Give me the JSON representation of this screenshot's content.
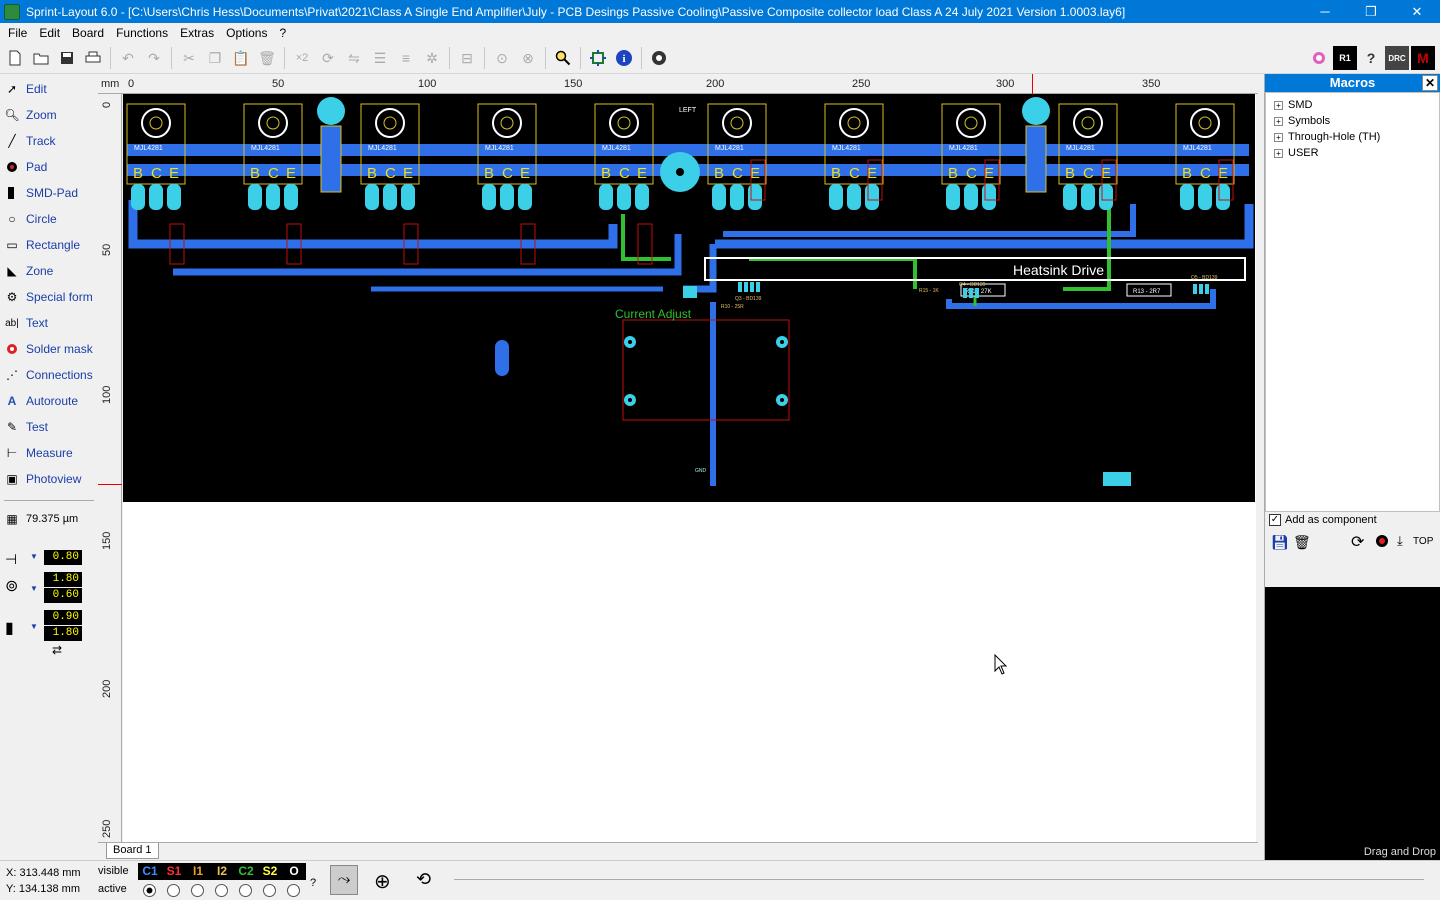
{
  "window": {
    "title": "Sprint-Layout 6.0 - [C:\\Users\\Chris Hess\\Documents\\Privat\\2021\\Class A Single End Amplifier\\July - PCB Desings Passive Cooling\\Passive Composite collector load Class A 24 July 2021 Version 1.0003.lay6]",
    "minimize": "─",
    "maximize": "❐",
    "close": "✕"
  },
  "menu": [
    "File",
    "Edit",
    "Board",
    "Functions",
    "Extras",
    "Options",
    "?"
  ],
  "toolbar": {
    "x2_label": "×2"
  },
  "tools": [
    {
      "label": "Edit",
      "icon": "pointer-icon"
    },
    {
      "label": "Zoom",
      "icon": "zoom-icon"
    },
    {
      "label": "Track",
      "icon": "track-icon"
    },
    {
      "label": "Pad",
      "icon": "pad-icon"
    },
    {
      "label": "SMD-Pad",
      "icon": "smd-pad-icon"
    },
    {
      "label": "Circle",
      "icon": "circle-icon"
    },
    {
      "label": "Rectangle",
      "icon": "rectangle-icon"
    },
    {
      "label": "Zone",
      "icon": "zone-icon"
    },
    {
      "label": "Special form",
      "icon": "special-form-icon"
    },
    {
      "label": "Text",
      "icon": "text-icon"
    },
    {
      "label": "Solder mask",
      "icon": "solder-mask-icon"
    },
    {
      "label": "Connections",
      "icon": "connections-icon"
    },
    {
      "label": "Autoroute",
      "icon": "autoroute-icon"
    },
    {
      "label": "Test",
      "icon": "test-icon"
    },
    {
      "label": "Measure",
      "icon": "measure-icon"
    },
    {
      "label": "Photoview",
      "icon": "photoview-icon"
    }
  ],
  "grid": {
    "value": "79.375 µm"
  },
  "params": {
    "track_width": "0.80",
    "pad_outer": "1.80",
    "pad_inner": "0.60",
    "smd_width": "0.90",
    "smd_height": "1.80"
  },
  "ruler": {
    "unit": "mm",
    "top_ticks": [
      "0",
      "50",
      "100",
      "150",
      "200",
      "250",
      "300",
      "350"
    ],
    "left_ticks": [
      "0",
      "50",
      "100",
      "150",
      "200",
      "250"
    ]
  },
  "pcb": {
    "transistor_label": "MJL4281",
    "pins": [
      "B",
      "C",
      "E"
    ],
    "heatsink_label": "Heatsink Drive",
    "current_adjust_label": "Current Adjust",
    "left_label": "LEFT",
    "gnd_label": "GND",
    "r10": "R10 - 25R",
    "r11": "R11 - 27K",
    "r13": "R13 - 2R7",
    "r15": "R15 - 1K",
    "q3": "Q3 - BD139",
    "q4": "Q4 - BD139",
    "q5": "Q5 - BD139"
  },
  "macros": {
    "title": "Macros",
    "tree": [
      "SMD",
      "Symbols",
      "Through-Hole (TH)",
      "USER"
    ],
    "add_as_component": "Add as component",
    "top_label": "TOP",
    "drag_drop": "Drag and Drop"
  },
  "tabs": [
    {
      "label": "Board 1"
    }
  ],
  "status": {
    "x": "X:  313.448 mm",
    "y": "Y:  134.138 mm",
    "visible": "visible",
    "active": "active",
    "question": "?",
    "layers": [
      {
        "name": "C1",
        "color": "#3c8cff"
      },
      {
        "name": "S1",
        "color": "#ff3030"
      },
      {
        "name": "I1",
        "color": "#e8a030"
      },
      {
        "name": "I2",
        "color": "#e8c060"
      },
      {
        "name": "C2",
        "color": "#30c030"
      },
      {
        "name": "S2",
        "color": "#ffff40"
      },
      {
        "name": "O",
        "color": "#ffffff"
      }
    ]
  }
}
